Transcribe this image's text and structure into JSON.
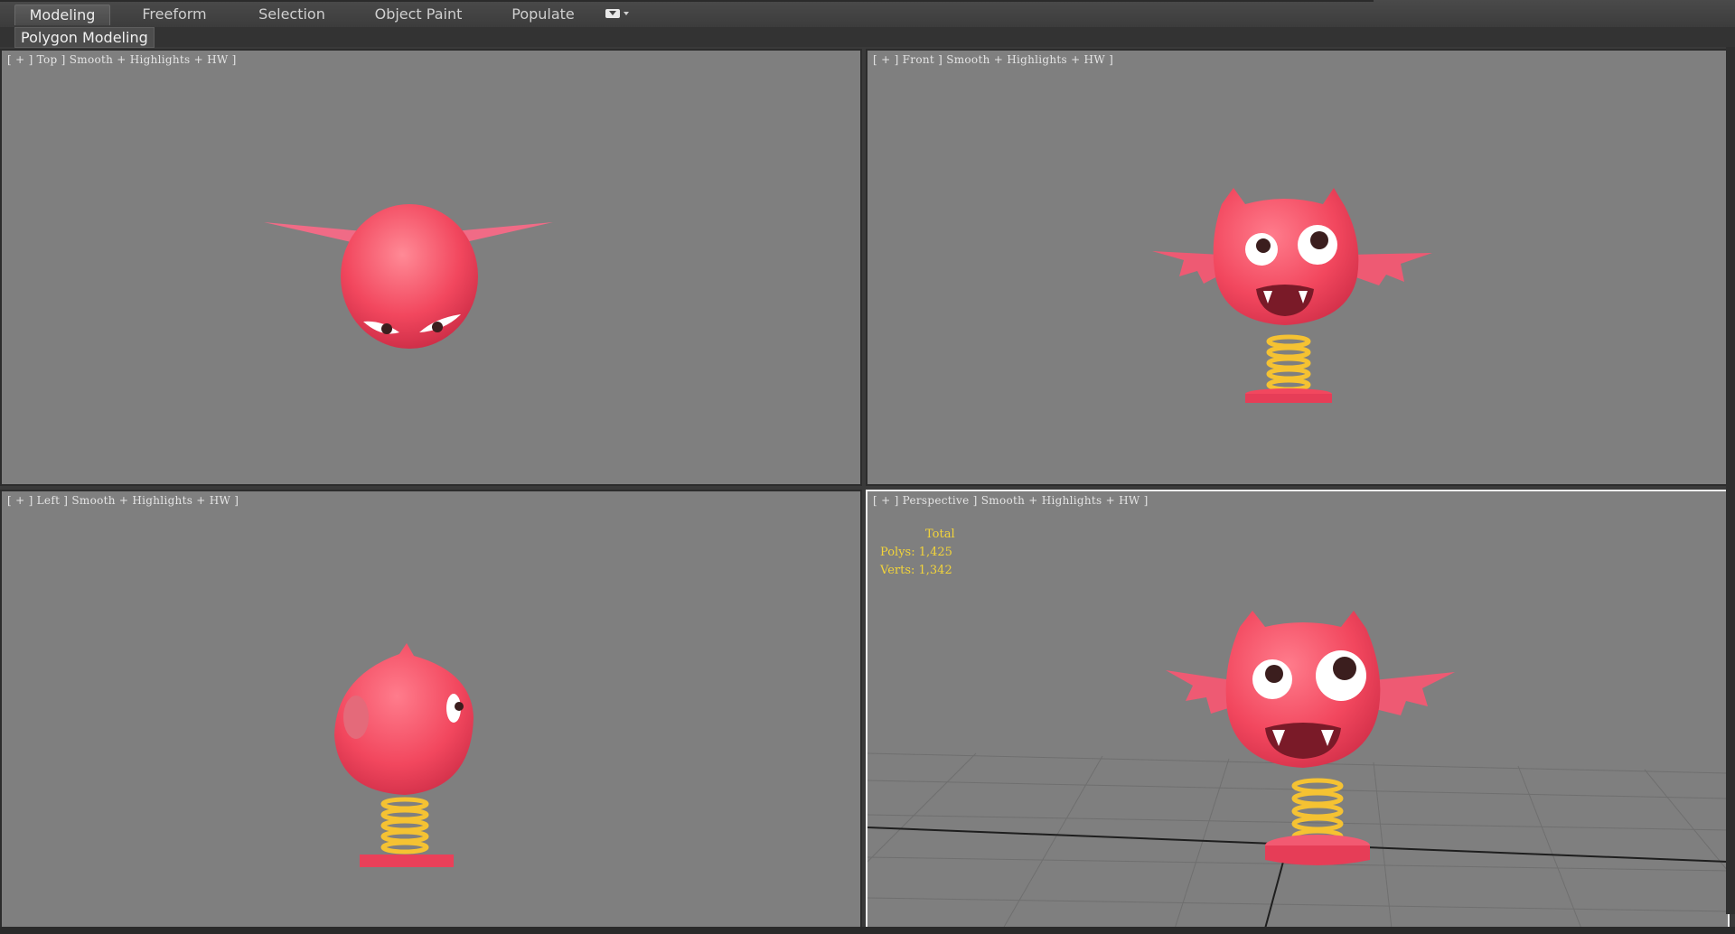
{
  "ribbon": {
    "tabs": [
      {
        "label": "Modeling",
        "active": true
      },
      {
        "label": "Freeform",
        "active": false
      },
      {
        "label": "Selection",
        "active": false
      },
      {
        "label": "Object Paint",
        "active": false
      },
      {
        "label": "Populate",
        "active": false
      }
    ],
    "panel_label": "Polygon Modeling"
  },
  "viewports": {
    "top": {
      "label": "[ + ] Top ] Smooth + Highlights + HW ]"
    },
    "front": {
      "label": "[ + ] Front ] Smooth + Highlights + HW ]"
    },
    "left": {
      "label": "[ + ] Left ] Smooth + Highlights + HW ]"
    },
    "perspective": {
      "label": "[ + ] Perspective ] Smooth + Highlights + HW ]"
    }
  },
  "stats": {
    "total": "Total",
    "polys": "Polys: 1,425",
    "verts": "Verts: 1,342"
  },
  "colors": {
    "viewport_bg": "#7f7f7f",
    "model_body": "#f2475e",
    "spring": "#f5c232",
    "stats_text": "#f2d43a"
  }
}
